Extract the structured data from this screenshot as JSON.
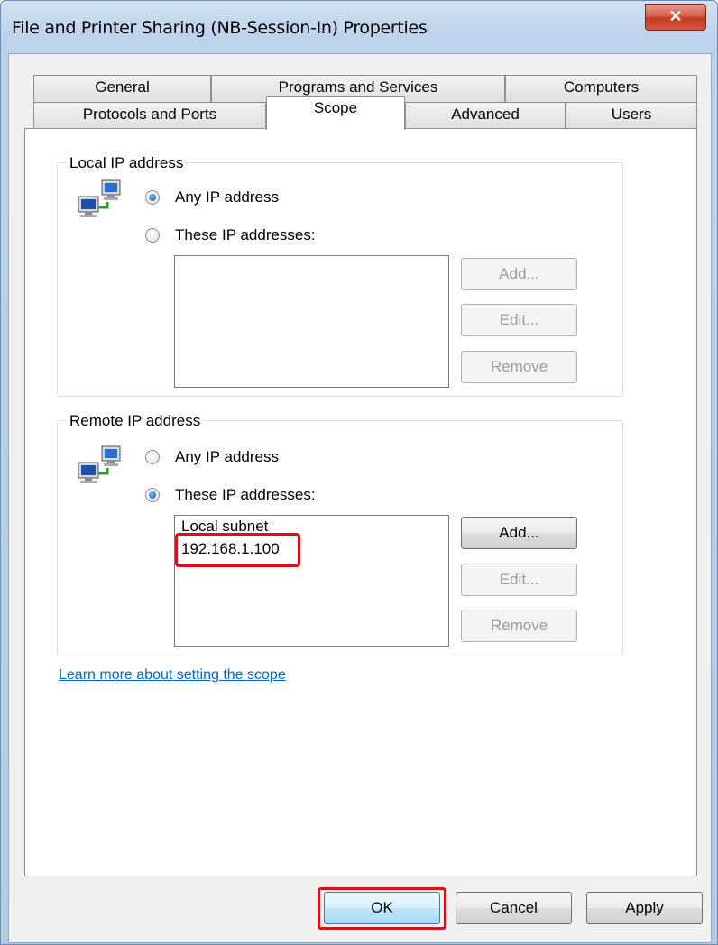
{
  "window": {
    "title": "File and Printer Sharing (NB-Session-In) Properties",
    "close_glyph": "✕"
  },
  "tabs": {
    "row1": [
      {
        "label": "General"
      },
      {
        "label": "Programs and Services"
      },
      {
        "label": "Computers"
      }
    ],
    "row2": [
      {
        "label": "Protocols and Ports"
      },
      {
        "label": "Scope"
      },
      {
        "label": "Advanced"
      },
      {
        "label": "Users"
      }
    ],
    "active": "Scope"
  },
  "local": {
    "legend": "Local IP address",
    "any_label": "Any IP address",
    "these_label": "These IP addresses:",
    "selected": "any",
    "entries": [],
    "add_label": "Add...",
    "edit_label": "Edit...",
    "remove_label": "Remove"
  },
  "remote": {
    "legend": "Remote IP address",
    "any_label": "Any IP address",
    "these_label": "These IP addresses:",
    "selected": "these",
    "entries": [
      "Local subnet",
      "192.168.1.100"
    ],
    "add_label": "Add...",
    "edit_label": "Edit...",
    "remove_label": "Remove"
  },
  "learn_more": "Learn more about setting the scope",
  "footer": {
    "ok_label": "OK",
    "cancel_label": "Cancel",
    "apply_label": "Apply"
  },
  "colors": {
    "highlight": "#d7111a",
    "link": "#0066cc",
    "radio_selected": "#1a5ea8"
  }
}
